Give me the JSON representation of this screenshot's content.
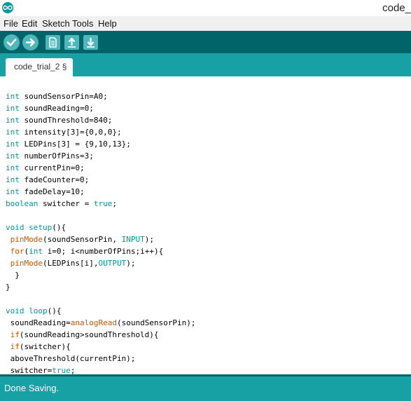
{
  "window": {
    "title": "code_",
    "app_icon": "arduino-infinity-icon"
  },
  "menu": {
    "items": [
      "File",
      "Edit",
      "Sketch",
      "Tools",
      "Help"
    ]
  },
  "toolbar": {
    "buttons": [
      {
        "name": "verify",
        "icon": "checkmark-icon"
      },
      {
        "name": "upload",
        "icon": "arrow-right-icon"
      },
      {
        "name": "new",
        "icon": "new-file-icon"
      },
      {
        "name": "open",
        "icon": "arrow-up-icon"
      },
      {
        "name": "save",
        "icon": "arrow-down-icon"
      }
    ]
  },
  "tabs": [
    {
      "label": "code_trial_2 §",
      "active": true
    }
  ],
  "editor": {
    "lines": [
      [
        {
          "t": "int",
          "c": "kw"
        },
        {
          "t": " soundSensorPin=A0;"
        }
      ],
      [
        {
          "t": "int",
          "c": "kw"
        },
        {
          "t": " soundReading=0;"
        }
      ],
      [
        {
          "t": "int",
          "c": "kw"
        },
        {
          "t": " soundThreshold=840;"
        }
      ],
      [
        {
          "t": "int",
          "c": "kw"
        },
        {
          "t": " intensity[3]={0,0,0};"
        }
      ],
      [
        {
          "t": "int",
          "c": "kw"
        },
        {
          "t": " LEDPins[3] = {9,10,13};"
        }
      ],
      [
        {
          "t": "int",
          "c": "kw"
        },
        {
          "t": " numberOfPins=3;"
        }
      ],
      [
        {
          "t": "int",
          "c": "kw"
        },
        {
          "t": " currentPin=0;"
        }
      ],
      [
        {
          "t": "int",
          "c": "kw"
        },
        {
          "t": " fadeCounter=0;"
        }
      ],
      [
        {
          "t": "int",
          "c": "kw"
        },
        {
          "t": " fadeDelay=10;"
        }
      ],
      [
        {
          "t": "boolean",
          "c": "kw"
        },
        {
          "t": " switcher = "
        },
        {
          "t": "true",
          "c": "kw"
        },
        {
          "t": ";"
        }
      ],
      [],
      [
        {
          "t": "void",
          "c": "kw"
        },
        {
          "t": " "
        },
        {
          "t": "setup",
          "c": "kw"
        },
        {
          "t": "(){"
        }
      ],
      [
        {
          "t": " "
        },
        {
          "t": "pinMode",
          "c": "fn"
        },
        {
          "t": "(soundSensorPin, "
        },
        {
          "t": "INPUT",
          "c": "kw"
        },
        {
          "t": ");"
        }
      ],
      [
        {
          "t": " "
        },
        {
          "t": "for",
          "c": "fn"
        },
        {
          "t": "("
        },
        {
          "t": "int",
          "c": "kw"
        },
        {
          "t": " i=0; i<numberOfPins;i++){"
        }
      ],
      [
        {
          "t": " "
        },
        {
          "t": "pinMode",
          "c": "fn"
        },
        {
          "t": "(LEDPins[i],"
        },
        {
          "t": "OUTPUT",
          "c": "kw"
        },
        {
          "t": ");"
        }
      ],
      [
        {
          "t": "  }"
        }
      ],
      [
        {
          "t": "}"
        }
      ],
      [],
      [
        {
          "t": "void",
          "c": "kw"
        },
        {
          "t": " "
        },
        {
          "t": "loop",
          "c": "kw"
        },
        {
          "t": "(){"
        }
      ],
      [
        {
          "t": " soundReading="
        },
        {
          "t": "analogRead",
          "c": "fn"
        },
        {
          "t": "(soundSensorPin);"
        }
      ],
      [
        {
          "t": " "
        },
        {
          "t": "if",
          "c": "fn"
        },
        {
          "t": "(soundReading>soundThreshold){"
        }
      ],
      [
        {
          "t": " "
        },
        {
          "t": "if",
          "c": "fn"
        },
        {
          "t": "(switcher){"
        }
      ],
      [
        {
          "t": " aboveThreshold(currentPin);"
        }
      ],
      [
        {
          "t": " switcher="
        },
        {
          "t": "true",
          "c": "kw"
        },
        {
          "t": ";"
        }
      ]
    ]
  },
  "status": {
    "message": "Done Saving."
  },
  "colors": {
    "toolbar": "#006468",
    "accent": "#17a1a5",
    "button": "#4db7bb",
    "keyword": "#00979c",
    "function": "#d35400"
  }
}
